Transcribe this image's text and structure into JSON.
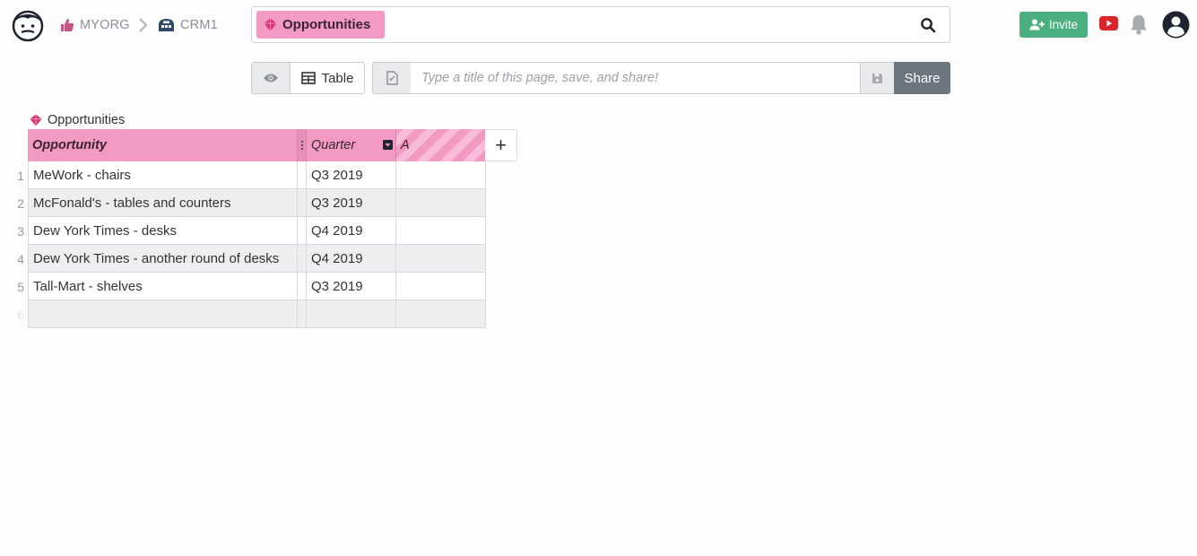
{
  "breadcrumb": {
    "org": "MYORG",
    "doc": "CRM1"
  },
  "search": {
    "chip_label": "Opportunities"
  },
  "header": {
    "invite_label": "Invite"
  },
  "toolbar": {
    "view_label": "Table",
    "title_placeholder": "Type a title of this page, save, and share!",
    "share_label": "Share"
  },
  "table": {
    "name": "Opportunities",
    "columns": [
      "Opportunity",
      "Quarter",
      "A"
    ],
    "rows": [
      {
        "num": "1",
        "opportunity": "MeWork - chairs",
        "quarter": "Q3 2019",
        "a": ""
      },
      {
        "num": "2",
        "opportunity": "McFonald's - tables and counters",
        "quarter": "Q3 2019",
        "a": ""
      },
      {
        "num": "3",
        "opportunity": "Dew York Times - desks",
        "quarter": "Q4 2019",
        "a": ""
      },
      {
        "num": "4",
        "opportunity": "Dew York Times - another round of desks",
        "quarter": "Q4 2019",
        "a": ""
      },
      {
        "num": "5",
        "opportunity": "Tall-Mart - shelves",
        "quarter": "Q3 2019",
        "a": ""
      },
      {
        "num": "6",
        "opportunity": "",
        "quarter": "",
        "a": ""
      }
    ]
  },
  "colors": {
    "accent": "#f29ac3",
    "invite": "#4caf7f",
    "share": "#6b7680",
    "row_alt": "#eceef0"
  },
  "icons": [
    "logo-icon",
    "thumbs-up-icon",
    "chevron-right-icon",
    "crm-icon",
    "gem-icon",
    "search-icon",
    "add-user-icon",
    "youtube-icon",
    "bell-icon",
    "account-icon",
    "eye-icon",
    "grid-icon",
    "document-icon",
    "save-icon",
    "drag-handle-icon",
    "dropdown-icon",
    "plus-icon"
  ]
}
